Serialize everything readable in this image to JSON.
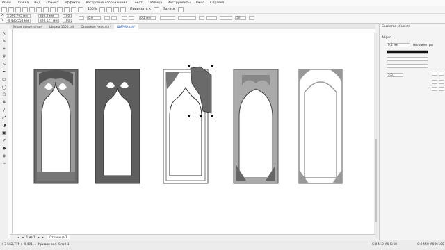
{
  "menu": [
    "Файл",
    "Правка",
    "Вид",
    "Объект",
    "Эффекты",
    "Растровые изображения",
    "Текст",
    "Таблица",
    "Инструменты",
    "Окно",
    "Справка"
  ],
  "toolbar": {
    "snap_label": "Привязать к",
    "launch_label": "Запуск",
    "zoom_value": "100%"
  },
  "propbar": {
    "x": "3 590,795 мм",
    "y": "-4 436,554 мм",
    "w": "380,0 мм",
    "h": "820,127 мм",
    "sx": "100,0",
    "sy": "100,0",
    "angle": "0,0",
    "outline": "0,2 мм",
    "num": "50"
  },
  "doc_tabs": [
    "Экран приветствия",
    "Ширма 1500.cdr",
    "Оснавное лицо.cdr",
    "ШИРМА.cdr*"
  ],
  "page": {
    "counter": "1 из 1",
    "page_tab": "Страница 1"
  },
  "docker": {
    "title": "Свойства объекта",
    "section": "Абрис",
    "width_value": "0,2 мм",
    "unit_label": "миллиметры",
    "corner_value": "5,0"
  },
  "status": {
    "coords": "( 3 562,775 ; -4 401,... )",
    "layer": "Кривая вкл. Слой 1",
    "fill": "C:0 M:0 Y:0 K:60",
    "outline": "C:0 M:0 Y:0 K:100"
  },
  "colors": {
    "accent": "#2255aa",
    "panel_dark": "#555555",
    "panel_mid": "#666666",
    "panel_light": "#999999",
    "outline": "#777777"
  }
}
